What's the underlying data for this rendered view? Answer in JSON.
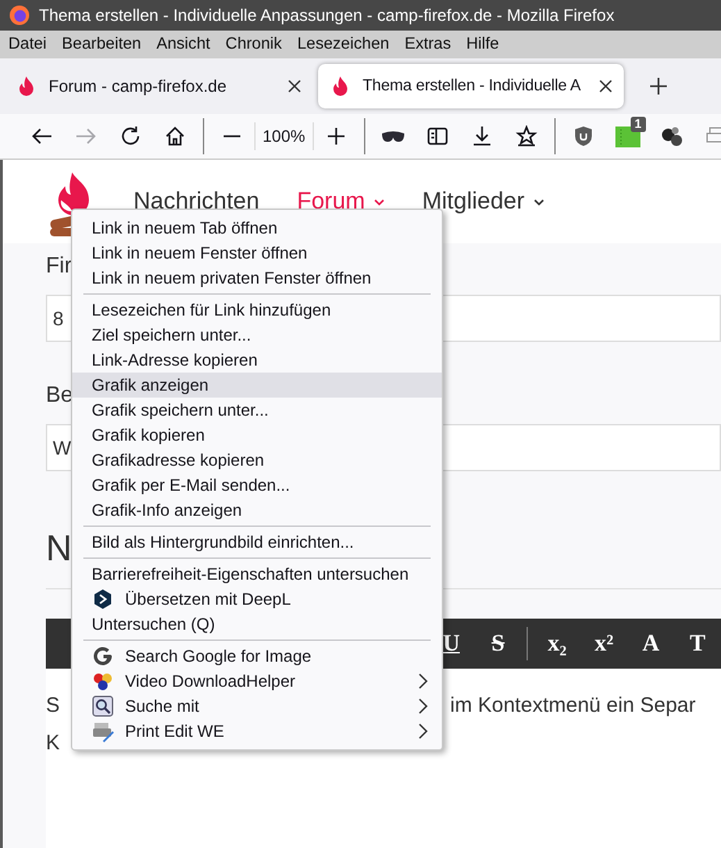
{
  "window": {
    "title": "Thema erstellen - Individuelle Anpassungen - camp-firefox.de - Mozilla Firefox"
  },
  "menu_bar": [
    "Datei",
    "Bearbeiten",
    "Ansicht",
    "Chronik",
    "Lesezeichen",
    "Extras",
    "Hilfe"
  ],
  "tabs": [
    {
      "label": "Forum - camp-firefox.de",
      "selected": false
    },
    {
      "label": "Thema erstellen - Individuelle A",
      "selected": true
    }
  ],
  "toolbar": {
    "forward_disabled": true,
    "zoom": "100%",
    "extension_badge": "1"
  },
  "site_nav": [
    {
      "label": "Nachrichten",
      "selected": false,
      "dropdown": false
    },
    {
      "label": "Forum",
      "selected": true,
      "dropdown": true
    },
    {
      "label": "Mitglieder",
      "selected": false,
      "dropdown": true
    }
  ],
  "form": {
    "field_1_label": "Fir",
    "field_1_value": "8",
    "field_2_label": "Be",
    "field_2_value": "W",
    "heading": "N"
  },
  "editor": {
    "buttons": [
      {
        "label": "U",
        "kind": "underline"
      },
      {
        "label": "S",
        "kind": "strike"
      },
      {
        "label": "x₂",
        "kind": "separator-before"
      },
      {
        "label": "x²",
        "kind": "plain"
      },
      {
        "label": "A",
        "kind": "plain"
      },
      {
        "label": "T",
        "kind": "plain"
      }
    ],
    "line_1_left": "S",
    "line_1_right": "im Kontextmenü ein Separ",
    "line_2_left": "K"
  },
  "context_menu": [
    {
      "kind": "item",
      "label": "Link in neuem Tab öffnen",
      "selected": false
    },
    {
      "kind": "item",
      "label": "Link in neuem Fenster öffnen",
      "selected": false
    },
    {
      "kind": "item",
      "label": "Link in neuem privaten Fenster öffnen",
      "selected": false
    },
    {
      "kind": "separator"
    },
    {
      "kind": "item",
      "label": "Lesezeichen für Link hinzufügen",
      "selected": false
    },
    {
      "kind": "item",
      "label": "Ziel speichern unter...",
      "selected": false
    },
    {
      "kind": "item",
      "label": "Link-Adresse kopieren",
      "selected": false
    },
    {
      "kind": "item",
      "label": "Grafik anzeigen",
      "selected": true
    },
    {
      "kind": "item",
      "label": "Grafik speichern unter...",
      "selected": false
    },
    {
      "kind": "item",
      "label": "Grafik kopieren",
      "selected": false
    },
    {
      "kind": "item",
      "label": "Grafikadresse kopieren",
      "selected": false
    },
    {
      "kind": "item",
      "label": "Grafik per E-Mail senden...",
      "selected": false
    },
    {
      "kind": "item",
      "label": "Grafik-Info anzeigen",
      "selected": false
    },
    {
      "kind": "separator"
    },
    {
      "kind": "item",
      "label": "Bild als Hintergrundbild einrichten...",
      "selected": false
    },
    {
      "kind": "separator"
    },
    {
      "kind": "item",
      "label": "Barrierefreiheit-Eigenschaften untersuchen",
      "selected": false
    },
    {
      "kind": "extension",
      "label": "Übersetzen mit DeepL",
      "selected": false,
      "submenu": false
    },
    {
      "kind": "item",
      "label": "Untersuchen (Q)",
      "selected": false
    },
    {
      "kind": "separator"
    },
    {
      "kind": "extension",
      "label": "Search Google for Image",
      "selected": false,
      "submenu": false
    },
    {
      "kind": "extension",
      "label": "Video DownloadHelper",
      "selected": false,
      "submenu": true
    },
    {
      "kind": "extension",
      "label": "Suche mit",
      "selected": false,
      "submenu": true
    },
    {
      "kind": "extension",
      "label": "Print Edit WE",
      "selected": false,
      "submenu": true
    }
  ]
}
